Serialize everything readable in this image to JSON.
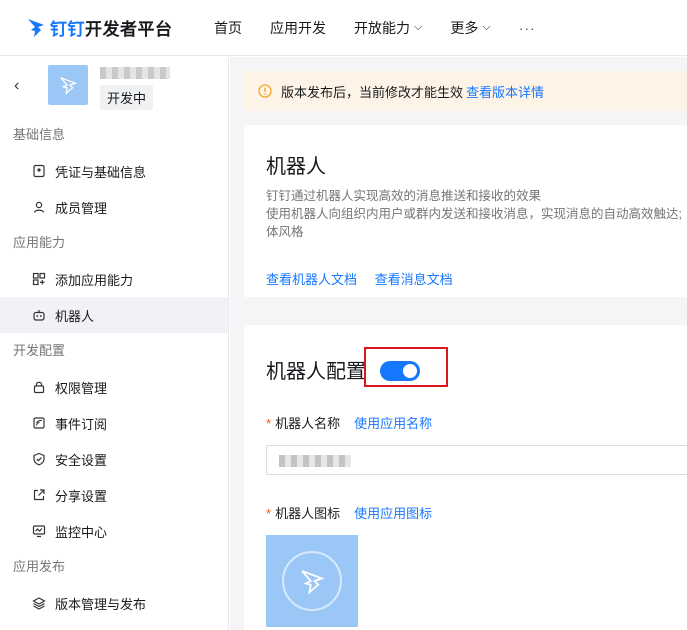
{
  "topbar": {
    "brand": "钉钉",
    "platform": "开发者平台",
    "nav": [
      {
        "label": "首页",
        "chevron": false
      },
      {
        "label": "应用开发",
        "chevron": false
      },
      {
        "label": "开放能力",
        "chevron": true
      },
      {
        "label": "更多",
        "chevron": true
      },
      {
        "label": "···",
        "chevron": false
      }
    ]
  },
  "sidebar": {
    "app_status": "开发中",
    "groups": {
      "basic": {
        "title": "基础信息",
        "items": [
          "凭证与基础信息",
          "成员管理"
        ]
      },
      "ability": {
        "title": "应用能力",
        "items": [
          "添加应用能力",
          "机器人"
        ]
      },
      "dev": {
        "title": "开发配置",
        "items": [
          "权限管理",
          "事件订阅",
          "安全设置",
          "分享设置",
          "监控中心"
        ]
      },
      "release": {
        "title": "应用发布",
        "items": [
          "版本管理与发布"
        ]
      }
    },
    "active_item": "机器人"
  },
  "notice": {
    "text": "版本发布后，当前修改才能生效",
    "link": "查看版本详情"
  },
  "robot_card": {
    "title": "机器人",
    "desc_line1": "钉钉通过机器人实现高效的消息推送和接收的效果",
    "desc_line2": "使用机器人向组织内用户或群内发送和接收消息，实现消息的自动高效触达;",
    "desc_line3": "体风格",
    "link_robot_doc": "查看机器人文档",
    "link_msg_doc": "查看消息文档"
  },
  "config_card": {
    "title": "机器人配置",
    "toggle_on": true,
    "name_label": "机器人名称",
    "name_use_app": "使用应用名称",
    "icon_label": "机器人图标",
    "icon_use_app": "使用应用图标"
  },
  "colors": {
    "accent": "#1677ff",
    "highlight_box": "#d9161d",
    "notice_bg": "#fdf3e6"
  }
}
